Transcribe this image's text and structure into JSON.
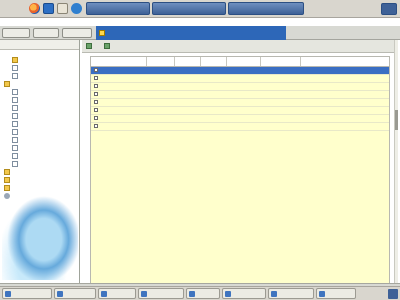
{
  "system_menu": {
    "items": [
      {
        "label": "",
        "icon": "app-menu-icon"
      },
      {
        "label": "",
        "icon": "places-icon"
      },
      {
        "label": "",
        "icon": "system-icon"
      }
    ],
    "launchers": [
      "browser-icon",
      "mail-icon",
      "text-editor-icon",
      "task-icon"
    ],
    "tasks": [
      {
        "label": ""
      },
      {
        "label": ""
      },
      {
        "label": ""
      }
    ]
  },
  "app": {
    "tab_title": ""
  },
  "left_panel": {
    "tree": [
      {
        "label": "",
        "icon": "folder",
        "indent": 1
      },
      {
        "label": "",
        "icon": "file",
        "indent": 1
      },
      {
        "label": "",
        "icon": "file",
        "indent": 1
      },
      {
        "label": "",
        "icon": "folder",
        "indent": 0
      },
      {
        "label": "",
        "icon": "file",
        "indent": 1,
        "selected": true
      },
      {
        "label": "",
        "icon": "file",
        "indent": 1
      },
      {
        "label": "",
        "icon": "file",
        "indent": 1
      },
      {
        "label": "",
        "icon": "file",
        "indent": 1
      },
      {
        "label": "",
        "icon": "file",
        "indent": 1
      },
      {
        "label": "",
        "icon": "file",
        "indent": 1
      },
      {
        "label": "",
        "icon": "file",
        "indent": 1
      },
      {
        "label": "",
        "icon": "file",
        "indent": 1
      },
      {
        "label": "",
        "icon": "file",
        "indent": 1
      },
      {
        "label": "",
        "icon": "file",
        "indent": 1
      },
      {
        "label": "",
        "icon": "folder",
        "indent": 0
      },
      {
        "label": "",
        "icon": "folder",
        "indent": 0
      },
      {
        "label": "",
        "icon": "folder",
        "indent": 0
      },
      {
        "label": "",
        "icon": "gear",
        "indent": 0
      }
    ]
  },
  "content": {
    "toolbar": [
      {
        "label": ""
      },
      {
        "label": ""
      }
    ],
    "columns": [
      "",
      "",
      "",
      "",
      "",
      ""
    ],
    "rows": [
      {
        "name": "",
        "col2": "",
        "selected": true
      },
      {
        "name": "",
        "col2": ""
      },
      {
        "name": "",
        "col2": ""
      },
      {
        "name": "",
        "col2": ""
      },
      {
        "name": "",
        "col2": ""
      },
      {
        "name": "",
        "col2": ""
      },
      {
        "name": "",
        "col2": ""
      },
      {
        "name": "",
        "col2": ""
      }
    ]
  },
  "taskbar": {
    "tasks": [
      {
        "label": ""
      },
      {
        "label": ""
      },
      {
        "label": ""
      },
      {
        "label": ""
      },
      {
        "label": ""
      },
      {
        "label": ""
      },
      {
        "label": ""
      },
      {
        "label": ""
      }
    ]
  },
  "colors": {
    "accent": "#3a6ec3",
    "grid_background": "#ffffcc",
    "tab_active": "#2d67b8"
  }
}
